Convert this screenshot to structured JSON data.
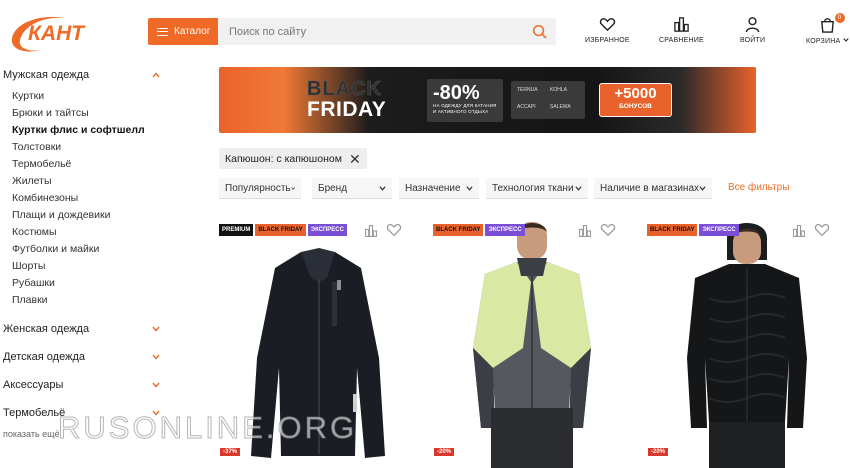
{
  "header": {
    "logo_text": "КАНТ",
    "catalog_label": "Каталог",
    "search_placeholder": "Поиск по сайту",
    "actions": [
      {
        "label": "ИЗБРАННОЕ",
        "icon": "heart-icon"
      },
      {
        "label": "СРАВНЕНИЕ",
        "icon": "compare-icon"
      },
      {
        "label": "ВОЙТИ",
        "icon": "user-icon"
      },
      {
        "label": "КОРЗИНА",
        "icon": "cart-icon",
        "badge": "0"
      }
    ]
  },
  "sidebar": {
    "open_category": "Мужская одежда",
    "subitems": [
      "Куртки",
      "Брюки и тайтсы",
      "Куртки флис и софтшелл",
      "Толстовки",
      "Термобельё",
      "Жилеты",
      "Комбинезоны",
      "Плащи и дождевики",
      "Костюмы",
      "Футболки и майки",
      "Шорты",
      "Рубашки",
      "Плавки"
    ],
    "active_index": 2,
    "categories": [
      "Женская одежда",
      "Детская одежда",
      "Аксессуары",
      "Термобельё"
    ],
    "show_more": "показать ещё"
  },
  "banner": {
    "line1": "BLACK",
    "line2": "FRIDAY",
    "discount": "-80%",
    "discount_sub": "НА ОДЕЖДУ ДЛЯ КАТАНИЯ И АКТИВНОГО ОТДЫХА",
    "brands": [
      "TERNUA",
      "KOHLA",
      "ACCAPI",
      "SALEWA"
    ],
    "bonus": "+5000",
    "bonus_label": "БОНУСОВ"
  },
  "active_filter": {
    "label": "Капюшон: с капюшоном"
  },
  "filters": [
    {
      "label": "Популярность"
    },
    {
      "label": "Бренд"
    },
    {
      "label": "Назначение"
    },
    {
      "label": "Технология ткани"
    },
    {
      "label": "Наличие в магазинах"
    }
  ],
  "all_filters_label": "Все фильтры",
  "products": [
    {
      "badges": [
        "PREMIUM",
        "BLACK FRIDAY",
        "ЭКСПРЕСС"
      ],
      "discount": "-37%",
      "colors": {
        "body": "#1a1d24",
        "sleeve": "#1a1d24",
        "accent": "#2a2e37"
      }
    },
    {
      "badges": [
        "BLACK FRIDAY",
        "ЭКСПРЕСС"
      ],
      "discount": "-20%",
      "colors": {
        "body": "#55595f",
        "sleeve": "#d9e8a3",
        "accent": "#3b3f45"
      }
    },
    {
      "badges": [
        "BLACK FRIDAY",
        "ЭКСПРЕСС"
      ],
      "discount": "-20%",
      "colors": {
        "body": "#151618",
        "sleeve": "#151618",
        "accent": "#262829"
      }
    }
  ],
  "watermark": "RUSONLINE.ORG",
  "colors": {
    "accent": "#ee6a26",
    "express": "#7a4fd6"
  }
}
